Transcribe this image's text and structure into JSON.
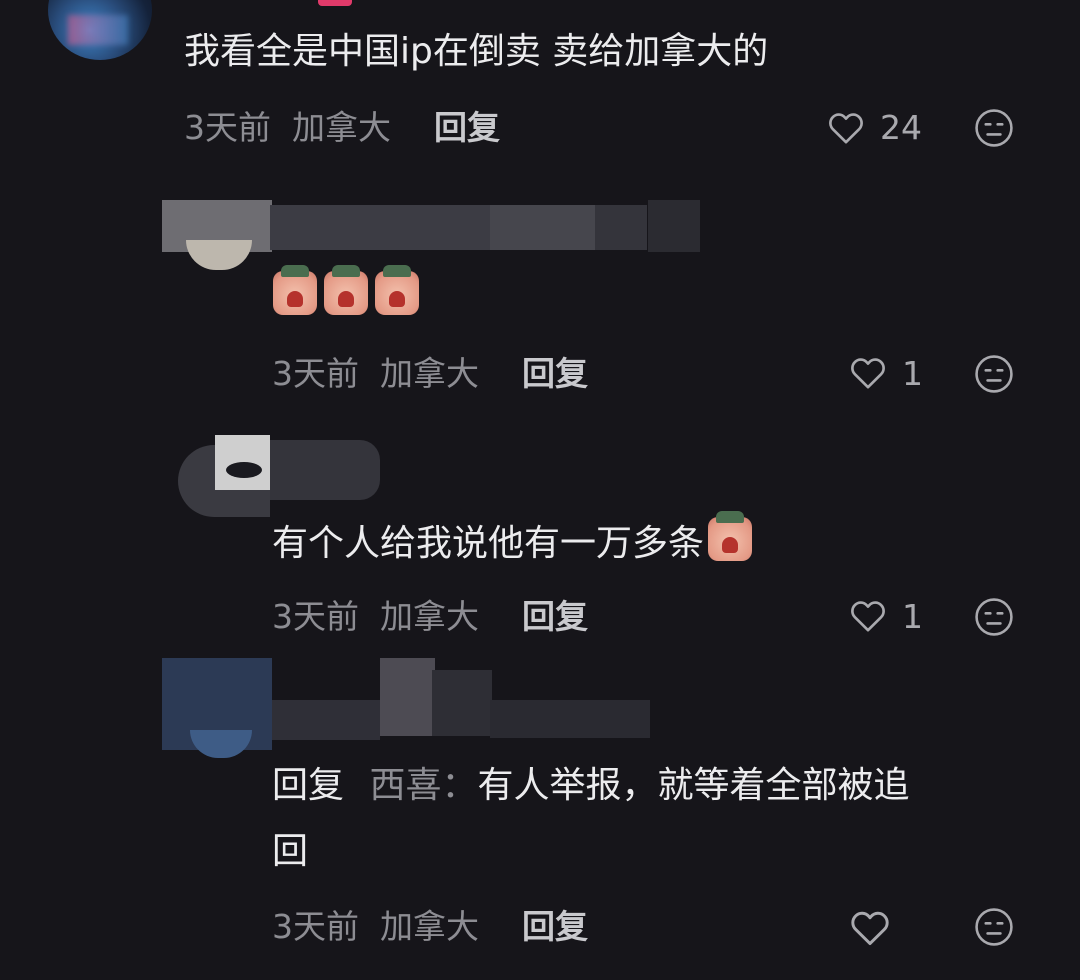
{
  "comments": [
    {
      "text": "我看全是中国ip在倒卖 卖给加拿大的",
      "time": "3天前",
      "location": "加拿大",
      "reply_label": "回复",
      "likes": "24"
    },
    {
      "emoji": [
        "crying-emoji",
        "crying-emoji",
        "crying-emoji"
      ],
      "time": "3天前",
      "location": "加拿大",
      "reply_label": "回复",
      "likes": "1"
    },
    {
      "text": "有个人给我说他有一万多条",
      "emoji": [
        "crying-emoji"
      ],
      "time": "3天前",
      "location": "加拿大",
      "reply_label": "回复",
      "likes": "1"
    },
    {
      "reply_prefix": "回复",
      "mention": "西喜：",
      "text_line1": "有人举报，就等着全部被追",
      "text_line2": "回",
      "time": "3天前",
      "location": "加拿大",
      "reply_label": "回复",
      "likes": ""
    }
  ],
  "colors": {
    "background": "#16151a",
    "meta_text": "#8d8d93",
    "body_text": "#ececee"
  }
}
